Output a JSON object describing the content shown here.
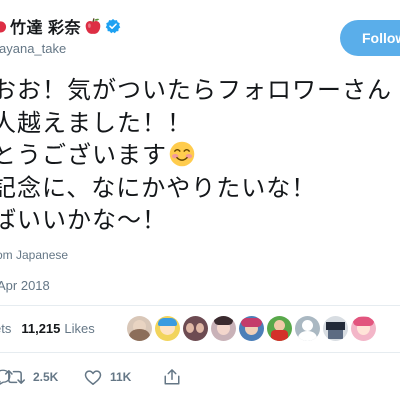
{
  "author": {
    "display_name": "竹達 彩奈",
    "handle": "ayana_take",
    "verified": true,
    "name_emoji": "red-apple"
  },
  "follow_button": {
    "label": "Follow"
  },
  "tweet": {
    "lines": [
      "おお！気がついたらフォロワーさん",
      "人越えました！！",
      "とうございます",
      "記念に、なにかやりたいな！",
      "ばいいかな〜！"
    ],
    "emoji": "smiling-face-with-blush",
    "translate_label": "om Japanese",
    "timestamp": "Apr 2018"
  },
  "stats": {
    "retweets_label": "ets",
    "likes_count": "11,215",
    "likes_label": "Likes",
    "liker_avatar_count": 9
  },
  "actions": {
    "retweet_count": "2.5K",
    "like_count": "11K"
  },
  "colors": {
    "follow_button": "#5aaeea",
    "verified_badge": "#1da1f2",
    "secondary_text": "#657786",
    "separator": "#e6ecf0"
  }
}
